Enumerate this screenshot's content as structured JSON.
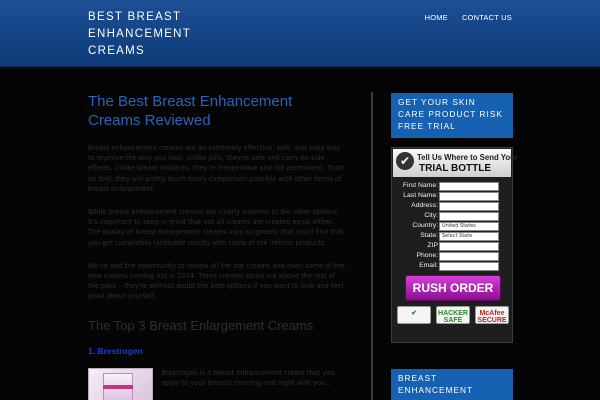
{
  "header": {
    "site_title": "BEST BREAST ENHANCEMENT CREAMS",
    "nav": [
      {
        "label": "HOME"
      },
      {
        "label": "CONTACT US"
      }
    ]
  },
  "main": {
    "title": "The Best Breast Enhancement Creams Reviewed",
    "paragraphs": [
      "Breast enhancement creams are an extremely effective, safe, and easy way to improve the way you look. Unlike pills, they're safe and carry no side effects. Unlike breast implants, they're inexpensive and not permanent. Truth be told, they win pretty much every comparison possible with other forms of breast enlargement.",
      "While breast enhancement creams are clearly superior to the other options, it's important to keep in mind that not all creams are created equal either. The quality of breast enlargement creams vary so greatly that you'll find that you get completely lackluster results with some of the inferior products.",
      "We've had the opportunity to review all the top creams and even some of the new creams coming out in 2014. Three creams stood out above the rest of the pack – they're without doubt the best options if you want to look and feel good about yourself."
    ],
    "section_heading": "The Top 3 Breast Enlargement Creams",
    "product_heading": "1. Brestrogen",
    "product_text": "Brestrogen is a breast enhancement cream that you apply to your breasts morning and night with you..."
  },
  "sidebar": {
    "widget1_title": "GET YOUR SKIN CARE PRODUCT RISK FREE TRIAL",
    "form": {
      "headline_line1": "Tell Us Where to Send Your",
      "headline_line2": "TRIAL BOTTLE",
      "fields": [
        {
          "label": "First Name:",
          "value": ""
        },
        {
          "label": "Last Name:",
          "value": ""
        },
        {
          "label": "Address:",
          "value": ""
        },
        {
          "label": "City:",
          "value": ""
        },
        {
          "label": "Country:",
          "value": "United States"
        },
        {
          "label": "State:",
          "value": "Select State"
        },
        {
          "label": "ZIP",
          "value": ""
        },
        {
          "label": "Phone:",
          "value": ""
        },
        {
          "label": "Email:",
          "value": ""
        }
      ],
      "submit_label": "RUSH ORDER",
      "badges": [
        {
          "label": "✔"
        },
        {
          "label": "HACKER SAFE"
        },
        {
          "label": "McAfee SECURE"
        }
      ]
    },
    "widget2_title": "BREAST ENHANCEMENT"
  }
}
